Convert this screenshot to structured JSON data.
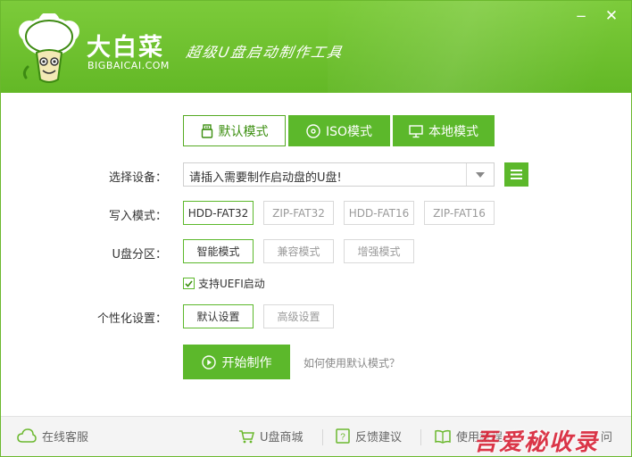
{
  "header": {
    "brand_name": "大白菜",
    "brand_domain": "BIGBAICAI.COM",
    "slogan": "超级U盘启动制作工具",
    "minimize_label": "−",
    "close_label": "✕"
  },
  "tabs": [
    {
      "label": "默认模式",
      "icon": "usb-drive-icon",
      "active": true
    },
    {
      "label": "ISO模式",
      "icon": "disc-icon",
      "active": false
    },
    {
      "label": "本地模式",
      "icon": "monitor-icon",
      "active": false
    }
  ],
  "device": {
    "label": "选择设备：",
    "value": "请插入需要制作启动盘的U盘!"
  },
  "write_mode": {
    "label": "写入模式：",
    "options": [
      "HDD-FAT32",
      "ZIP-FAT32",
      "HDD-FAT16",
      "ZIP-FAT16"
    ],
    "selected": "HDD-FAT32"
  },
  "partition": {
    "label": "U盘分区：",
    "options": [
      "智能模式",
      "兼容模式",
      "增强模式"
    ],
    "selected": "智能模式"
  },
  "uefi": {
    "label": "支持UEFI启动",
    "checked": true
  },
  "personalize": {
    "label": "个性化设置：",
    "options": [
      "默认设置",
      "高级设置"
    ],
    "selected": "默认设置"
  },
  "actions": {
    "start_label": "开始制作",
    "help_link": "如何使用默认模式？"
  },
  "footer": {
    "service": "在线客服",
    "shop": "U盘商城",
    "feedback": "反馈建议",
    "tutorial": "使用教程",
    "extra": "问"
  },
  "watermark": "吾爱秘收录",
  "colors": {
    "accent": "#5cb82b",
    "header": "#6bbf2e",
    "watermark": "#d8263a"
  }
}
